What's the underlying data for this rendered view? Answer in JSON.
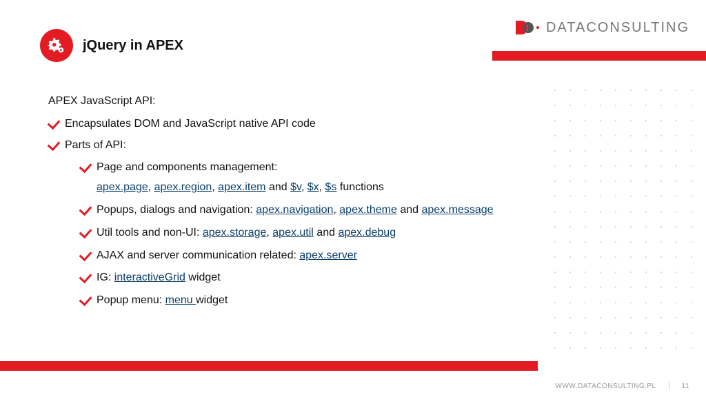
{
  "brand": {
    "name_a": "DATA",
    "name_b": "CONSULTING"
  },
  "title": "jQuery in APEX",
  "lead": "APEX JavaScript API:",
  "bullets": {
    "b1": "Encapsulates DOM and JavaScript native API code",
    "b2": "Parts of API:",
    "s1_pre": "Page and components management:",
    "s1_links": {
      "a": "apex.page",
      "b": "apex.region",
      "c": "apex.item",
      "d": "$v",
      "e": "$x",
      "f": "$s"
    },
    "s1_mid1": ", ",
    "s1_mid2": ", ",
    "s1_and1": " and ",
    "s1_mid3": ", ",
    "s1_mid4": ", ",
    "s1_tail": " functions",
    "s2_pre": "Popups, dialogs and navigation: ",
    "s2_links": {
      "a": "apex.navigation",
      "b": "apex.theme",
      "c": "apex.message"
    },
    "s2_mid": ", ",
    "s2_and": " and ",
    "s3_pre": "Util tools and non-UI: ",
    "s3_links": {
      "a": "apex.storage",
      "b": "apex.util",
      "c": "apex.debug"
    },
    "s3_mid": ", ",
    "s3_and": " and ",
    "s4_pre": "AJAX and server communication related: ",
    "s4_link": "apex.server",
    "s5_pre": "IG: ",
    "s5_link": "interactiveGrid",
    "s5_tail": " widget",
    "s6_pre": "Popup menu: ",
    "s6_link": "menu ",
    "s6_tail": "widget"
  },
  "footer": {
    "url": "WWW.DATACONSULTING.PL",
    "page": "11"
  }
}
